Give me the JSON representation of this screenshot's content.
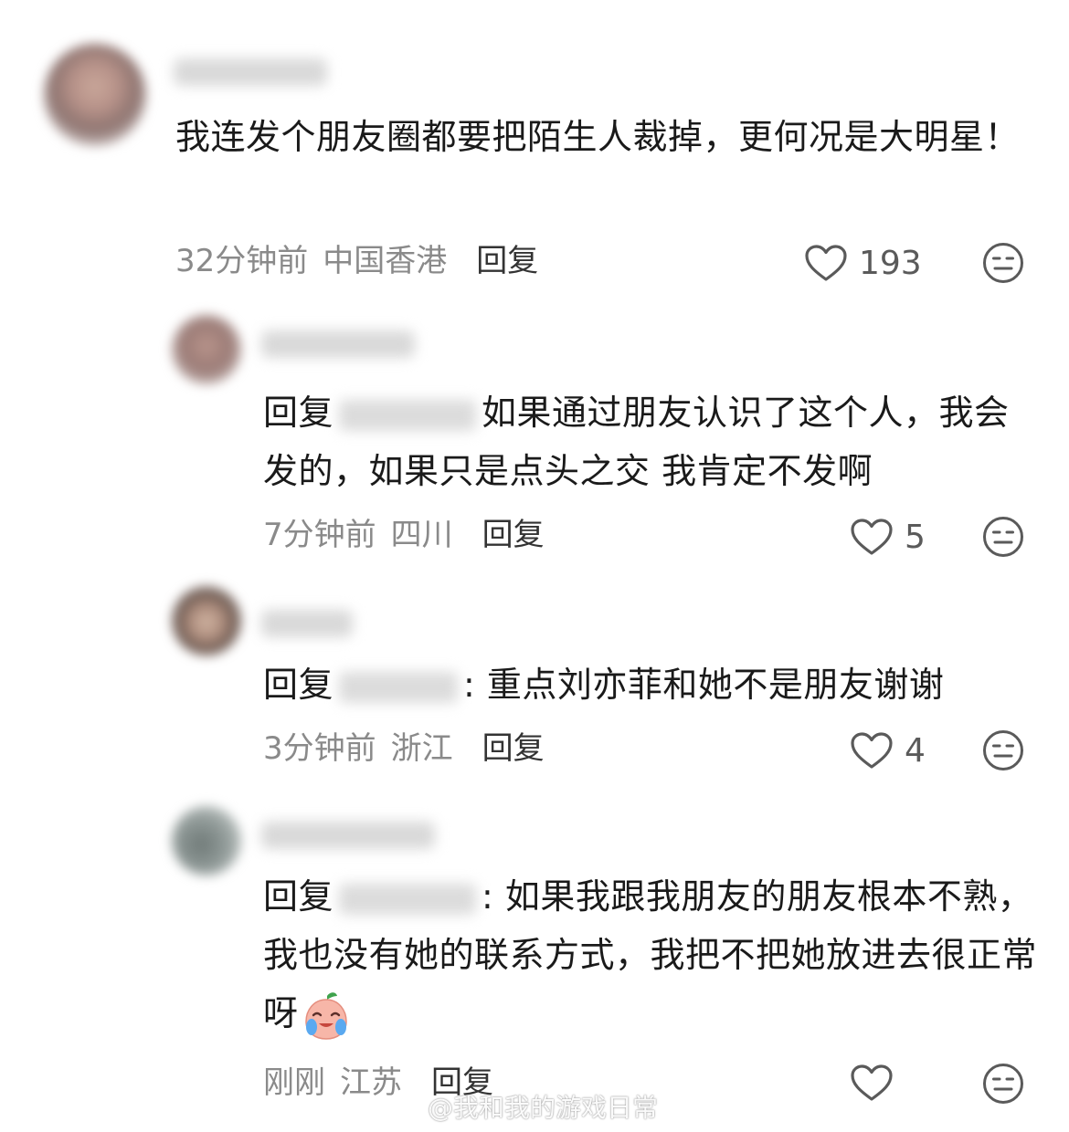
{
  "comments": [
    {
      "text": "我连发个朋友圈都要把陌生人裁掉，更何况是大明星！",
      "time": "32分钟前",
      "location": "中国香港",
      "reply_label": "回复",
      "likes": "193"
    },
    {
      "reply_prefix": "回复",
      "text": "如果通过朋友认识了这个人，我会发的，如果只是点头之交  我肯定不发啊",
      "time": "7分钟前",
      "location": "四川",
      "reply_label": "回复",
      "likes": "5"
    },
    {
      "reply_prefix": "回复",
      "text": ": 重点刘亦菲和她不是朋友谢谢",
      "time": "3分钟前",
      "location": "浙江",
      "reply_label": "回复",
      "likes": "4"
    },
    {
      "reply_prefix": "回复",
      "text": ": 如果我跟我朋友的朋友根本不熟，我也没有她的联系方式，我把不把她放进去很正常呀",
      "time": "刚刚",
      "location": "江苏",
      "reply_label": "回复",
      "likes": ""
    }
  ],
  "watermark": "@我和我的游戏日常",
  "icons": {
    "like": "heart-outline-icon",
    "dislike": "meh-face-icon",
    "emoji": "crying-peach-emoji",
    "watermark_logo": "weibo-logo"
  },
  "colors": {
    "text": "#1a1a1a",
    "meta": "#8a8a8a",
    "icon": "#5a5a5a"
  }
}
